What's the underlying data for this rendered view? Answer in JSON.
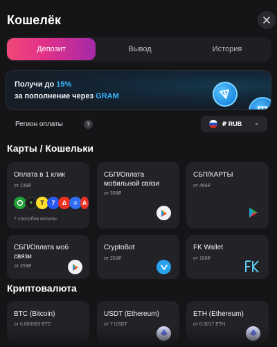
{
  "header": {
    "title": "Кошелёк",
    "close_icon": "close-icon"
  },
  "tabs": [
    {
      "label": "Депозит",
      "active": true
    },
    {
      "label": "Вывод",
      "active": false
    },
    {
      "label": "История",
      "active": false
    }
  ],
  "promo": {
    "line1_prefix": "Получи до ",
    "line1_highlight": "15%",
    "line2_prefix": "за пополнение через ",
    "line2_highlight": "GRAM",
    "accent_color": "#38b6ff"
  },
  "region": {
    "label": "Регион оплаты",
    "help": "?",
    "currency": "₽ RUB",
    "flag": "russia-flag-icon"
  },
  "sections": {
    "cards_title": "Карты / Кошельки",
    "crypto_title": "Криптовалюта"
  },
  "cards": [
    {
      "name": "Оплата в 1 клик",
      "min": "от 236₽",
      "methods": "7 способов оплаты",
      "logos": [
        "sber-icon",
        "tbank-icon",
        "tochka-icon",
        "alfa-icon",
        "alfa-red-icon"
      ]
    },
    {
      "name": "СБП/Оплата мобильной связи",
      "min": "от 358₽",
      "icon": "sbp-icon"
    },
    {
      "name": "СБП/КАРТЫ",
      "min": "от 466₽",
      "icon": "sbp-icon"
    },
    {
      "name": "СБП/Оплата моб связи",
      "min": "от 358₽",
      "icon": "sbp-icon"
    },
    {
      "name": "CryptoBot",
      "min": "от 250₽",
      "icon": "cryptobot-icon"
    },
    {
      "name": "FK Wallet",
      "min": "от 100₽",
      "icon": "fk-wallet-logo"
    }
  ],
  "crypto": [
    {
      "name": "BTC (Bitcoin)",
      "min": "от 0.000083 BTC"
    },
    {
      "name": "USDT (Ethereum)",
      "min": "от 7 USDT"
    },
    {
      "name": "ETH (Ethereum)",
      "min": "от 0.0017 ETH"
    }
  ],
  "colors": {
    "background": "#151517",
    "card": "#232327",
    "tab_gradient_start": "#f04877",
    "tab_gradient_end": "#a42aa6"
  }
}
